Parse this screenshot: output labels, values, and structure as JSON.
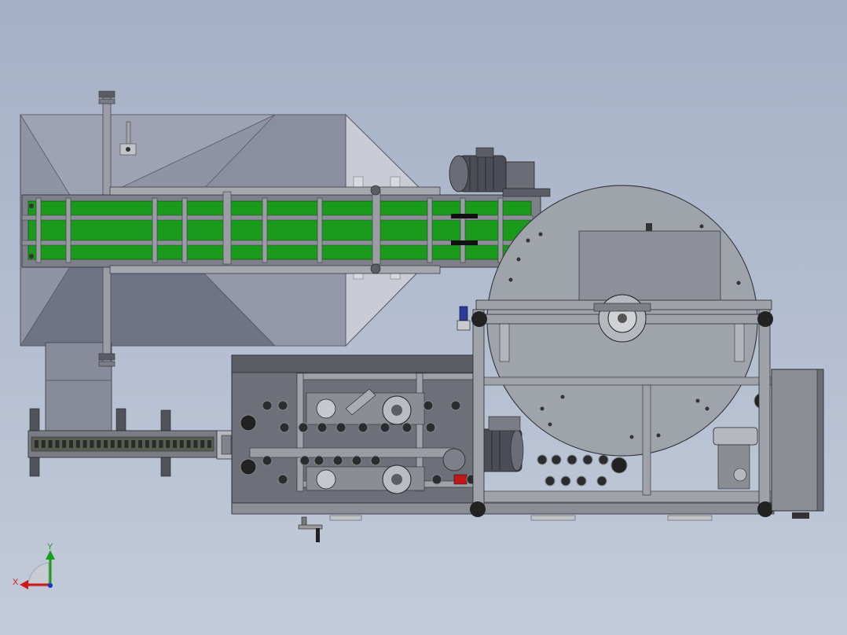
{
  "viewport": {
    "background_top": "#a4b0c6",
    "background_bottom": "#c3cbda"
  },
  "model": {
    "belt_color": "#1a9a1a",
    "frame_color": "#8a8d93",
    "drum_color": "#9fa3aa",
    "dark_color": "#3a3d42"
  },
  "triad": {
    "x_label": "X",
    "y_label": "Y",
    "x_color": "#d01818",
    "y_color": "#18a018",
    "z_color": "#1830c8"
  }
}
